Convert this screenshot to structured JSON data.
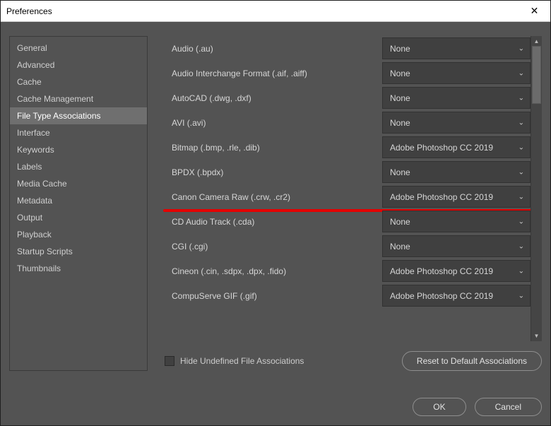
{
  "window": {
    "title": "Preferences"
  },
  "sidebar": {
    "items": [
      {
        "label": "General"
      },
      {
        "label": "Advanced"
      },
      {
        "label": "Cache"
      },
      {
        "label": "Cache Management"
      },
      {
        "label": "File Type Associations",
        "selected": true
      },
      {
        "label": "Interface"
      },
      {
        "label": "Keywords"
      },
      {
        "label": "Labels"
      },
      {
        "label": "Media Cache"
      },
      {
        "label": "Metadata"
      },
      {
        "label": "Output"
      },
      {
        "label": "Playback"
      },
      {
        "label": "Startup Scripts"
      },
      {
        "label": "Thumbnails"
      }
    ]
  },
  "associations": {
    "rows": [
      {
        "label": "Audio (.au)",
        "value": "None"
      },
      {
        "label": "Audio Interchange Format (.aif, .aiff)",
        "value": "None"
      },
      {
        "label": "AutoCAD (.dwg, .dxf)",
        "value": "None"
      },
      {
        "label": "AVI (.avi)",
        "value": "None"
      },
      {
        "label": "Bitmap (.bmp, .rle, .dib)",
        "value": "Adobe Photoshop CC 2019"
      },
      {
        "label": "BPDX (.bpdx)",
        "value": "None"
      },
      {
        "label": "Canon Camera Raw (.crw, .cr2)",
        "value": "Adobe Photoshop CC 2019",
        "highlight": true
      },
      {
        "label": "CD Audio Track (.cda)",
        "value": "None"
      },
      {
        "label": "CGI (.cgi)",
        "value": "None"
      },
      {
        "label": "Cineon (.cin, .sdpx, .dpx, .fido)",
        "value": "Adobe Photoshop CC 2019"
      },
      {
        "label": "CompuServe GIF (.gif)",
        "value": "Adobe Photoshop CC 2019"
      }
    ]
  },
  "below": {
    "hide_label": "Hide Undefined File Associations",
    "reset_label": "Reset to Default Associations"
  },
  "footer": {
    "ok": "OK",
    "cancel": "Cancel"
  }
}
